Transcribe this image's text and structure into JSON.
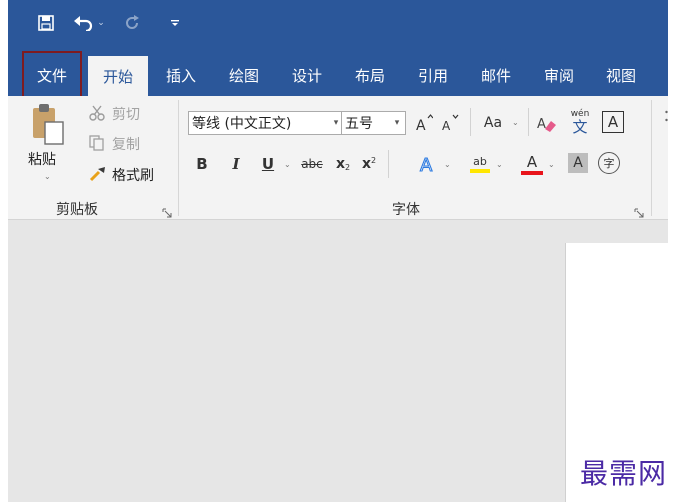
{
  "quick_access": {
    "save_icon": "save-icon",
    "undo_icon": "undo-icon",
    "redo_icon": "redo-icon",
    "more_icon": "customize-quick-access-icon"
  },
  "tabs": [
    {
      "label": "文件",
      "active": false
    },
    {
      "label": "开始",
      "active": true
    },
    {
      "label": "插入",
      "active": false
    },
    {
      "label": "绘图",
      "active": false
    },
    {
      "label": "设计",
      "active": false
    },
    {
      "label": "布局",
      "active": false
    },
    {
      "label": "引用",
      "active": false
    },
    {
      "label": "邮件",
      "active": false
    },
    {
      "label": "审阅",
      "active": false
    },
    {
      "label": "视图",
      "active": false
    }
  ],
  "clipboard": {
    "paste_label": "粘贴",
    "cut_label": "剪切",
    "copy_label": "复制",
    "format_painter_label": "格式刷",
    "group_label": "剪贴板"
  },
  "font": {
    "font_name": "等线 (中文正文)",
    "font_size": "五号",
    "change_case_label": "Aa",
    "phonetic_top": "wén",
    "phonetic_bottom": "文",
    "border_char": "A",
    "bold": "B",
    "italic": "I",
    "underline": "U",
    "strikethrough": "abc",
    "subscript_base": "x",
    "subscript_mark": "2",
    "superscript_base": "x",
    "superscript_mark": "2",
    "highlight_text": "ab",
    "font_color_char": "A",
    "shading_char": "A",
    "enclose_char": "字",
    "group_label": "字体"
  },
  "colors": {
    "title_bar": "#2b579a",
    "ribbon": "#f3f3f3",
    "file_highlight_border": "#7e1b20",
    "highlight_yellow": "#ffe600",
    "font_color_red": "#e8141b",
    "watermark": "#4b2aa5"
  },
  "watermark": "最需网"
}
